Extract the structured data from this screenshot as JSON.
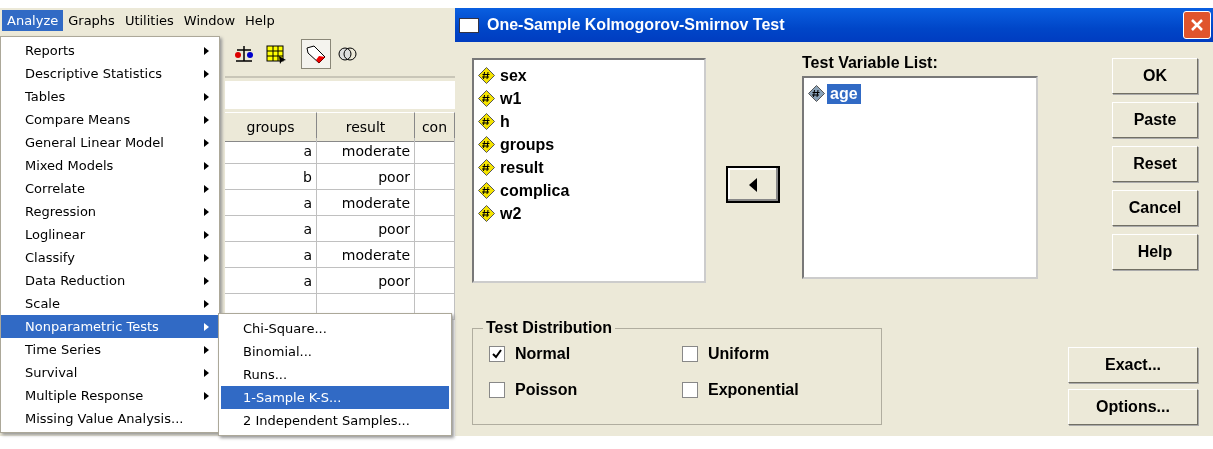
{
  "menu_bar": [
    {
      "label": "Analyze",
      "selected": true
    },
    {
      "label": "Graphs",
      "selected": false
    },
    {
      "label": "Utilities",
      "selected": false
    },
    {
      "label": "Window",
      "selected": false
    },
    {
      "label": "Help",
      "selected": false
    }
  ],
  "analyze_menu": [
    {
      "label": "Reports",
      "submenu": true,
      "selected": false
    },
    {
      "label": "Descriptive Statistics",
      "submenu": true,
      "selected": false
    },
    {
      "label": "Tables",
      "submenu": true,
      "selected": false
    },
    {
      "label": "Compare Means",
      "submenu": true,
      "selected": false
    },
    {
      "label": "General Linear Model",
      "submenu": true,
      "selected": false
    },
    {
      "label": "Mixed Models",
      "submenu": true,
      "selected": false
    },
    {
      "label": "Correlate",
      "submenu": true,
      "selected": false
    },
    {
      "label": "Regression",
      "submenu": true,
      "selected": false
    },
    {
      "label": "Loglinear",
      "submenu": true,
      "selected": false
    },
    {
      "label": "Classify",
      "submenu": true,
      "selected": false
    },
    {
      "label": "Data Reduction",
      "submenu": true,
      "selected": false
    },
    {
      "label": "Scale",
      "submenu": true,
      "selected": false
    },
    {
      "label": "Nonparametric Tests",
      "submenu": true,
      "selected": true
    },
    {
      "label": "Time Series",
      "submenu": true,
      "selected": false
    },
    {
      "label": "Survival",
      "submenu": true,
      "selected": false
    },
    {
      "label": "Multiple Response",
      "submenu": true,
      "selected": false
    },
    {
      "label": "Missing Value Analysis...",
      "submenu": false,
      "selected": false
    }
  ],
  "nonparametric_submenu": [
    {
      "label": "Chi-Square...",
      "selected": false
    },
    {
      "label": "Binomial...",
      "selected": false
    },
    {
      "label": "Runs...",
      "selected": false
    },
    {
      "label": "1-Sample K-S...",
      "selected": true
    },
    {
      "label": "2 Independent Samples...",
      "selected": false
    }
  ],
  "data_grid": {
    "columns": [
      "groups",
      "result",
      "con"
    ],
    "rows": [
      [
        "a",
        "moderate"
      ],
      [
        "b",
        "poor"
      ],
      [
        "a",
        "moderate"
      ],
      [
        "a",
        "poor"
      ],
      [
        "a",
        "moderate"
      ],
      [
        "a",
        "poor"
      ]
    ]
  },
  "dialog": {
    "title": "One-Sample Kolmogorov-Smirnov Test",
    "source_variables": [
      {
        "name": "sex",
        "selected": false
      },
      {
        "name": "w1",
        "selected": false
      },
      {
        "name": "h",
        "selected": false
      },
      {
        "name": "groups",
        "selected": false
      },
      {
        "name": "result",
        "selected": false
      },
      {
        "name": "complica",
        "selected": false
      },
      {
        "name": "w2",
        "selected": false
      }
    ],
    "test_variable_list": {
      "label": "Test Variable List:",
      "items": [
        {
          "name": "age",
          "selected": true
        }
      ]
    },
    "buttons": [
      "OK",
      "Paste",
      "Reset",
      "Cancel",
      "Help"
    ],
    "test_distribution": {
      "title": "Test Distribution",
      "options": [
        {
          "label": "Normal",
          "checked": true
        },
        {
          "label": "Uniform",
          "checked": false
        },
        {
          "label": "Poisson",
          "checked": false
        },
        {
          "label": "Exponential",
          "checked": false
        }
      ]
    },
    "extra_buttons": [
      "Exact...",
      "Options..."
    ]
  }
}
